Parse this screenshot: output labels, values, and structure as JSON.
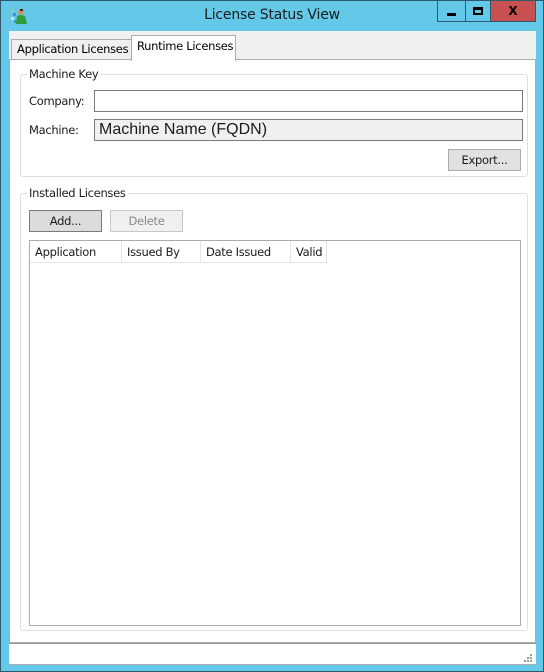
{
  "window": {
    "title": "License Status View",
    "icon": "license-user-icon",
    "controls": {
      "minimize": "minimize-icon",
      "maximize": "maximize-icon",
      "close_label": "X"
    }
  },
  "tabs": [
    {
      "label": "Application Licenses",
      "selected": false
    },
    {
      "label": "Runtime Licenses",
      "selected": true
    }
  ],
  "machine_key": {
    "title": "Machine Key",
    "company_label": "Company:",
    "company_value": "",
    "machine_label": "Machine:",
    "machine_value": "Machine Name (FQDN)",
    "export_label": "Export..."
  },
  "installed_licenses": {
    "title": "Installed Licenses",
    "add_label": "Add...",
    "delete_label": "Delete",
    "delete_enabled": false,
    "columns": [
      "Application",
      "Issued By",
      "Date Issued",
      "Valid"
    ],
    "rows": []
  },
  "status_bar": {
    "text": ""
  }
}
